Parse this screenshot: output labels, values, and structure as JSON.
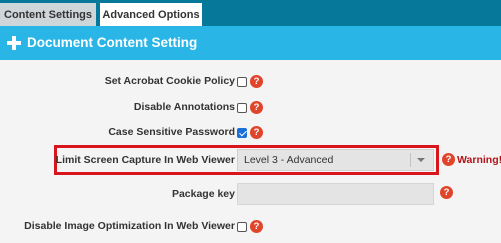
{
  "tabs": {
    "content_settings": "Content Settings",
    "advanced_options": "Advanced Options"
  },
  "section": {
    "title": "Document Content Setting"
  },
  "fields": {
    "acrobat_cookie": {
      "label": "Set Acrobat Cookie Policy",
      "checked": false
    },
    "disable_annotations": {
      "label": "Disable Annotations",
      "checked": false
    },
    "case_sensitive_password": {
      "label": "Case Sensitive Password",
      "checked": true
    },
    "limit_screen_capture": {
      "label": "Limit Screen Capture In Web Viewer",
      "selected": "Level 3 - Advanced",
      "warning": "Warning!"
    },
    "package_key": {
      "label": "Package key",
      "value": ""
    },
    "disable_image_optimization": {
      "label": "Disable Image Optimization In Web Viewer",
      "checked": false
    }
  },
  "help_glyph": "?",
  "colors": {
    "tabbar": "#06799a",
    "header": "#29b5e6",
    "help_icon": "#e0452b",
    "highlight_border": "#d8151b",
    "warning_text": "#b3121a",
    "checkbox_checked": "#1a6fd8"
  }
}
